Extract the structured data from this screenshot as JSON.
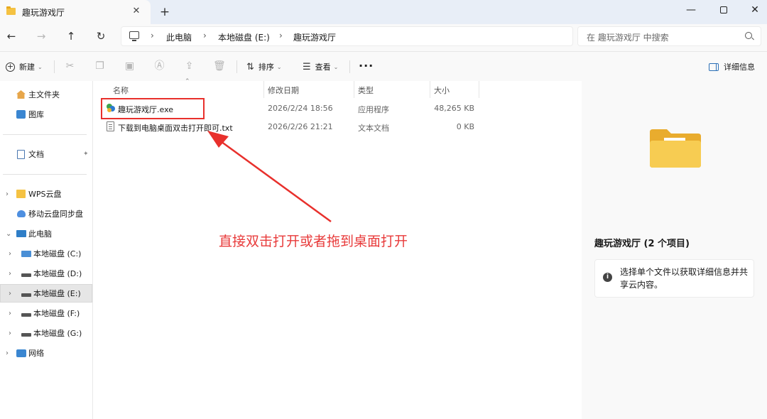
{
  "window": {
    "tab_title": "趣玩游戏厅",
    "tab_close": "✕",
    "new_tab": "+",
    "minimize": "—",
    "close": "✕"
  },
  "nav": {
    "back": "←",
    "forward": "→",
    "up": "↑",
    "refresh": "↻"
  },
  "breadcrumb": [
    {
      "label": "此电脑"
    },
    {
      "label": "本地磁盘 (E:)"
    },
    {
      "label": "趣玩游戏厅"
    }
  ],
  "breadcrumb_separator": "›",
  "search": {
    "placeholder": "在 趣玩游戏厅 中搜索"
  },
  "toolbar": {
    "new_label": "新建",
    "sort_label": "排序",
    "view_label": "查看",
    "more": "···",
    "details_label": "详细信息",
    "caret": "⌄"
  },
  "sidebar": {
    "items": [
      {
        "label": "主文件夹",
        "icon": "home-icon"
      },
      {
        "label": "图库",
        "icon": "gallery-icon"
      },
      {
        "label": "文档",
        "icon": "document-icon"
      },
      {
        "label": "WPS云盘",
        "icon": "folder-icon"
      },
      {
        "label": "移动云盘同步盘",
        "icon": "cloud-icon"
      },
      {
        "label": "此电脑",
        "icon": "computer-icon"
      },
      {
        "label": "本地磁盘 (C:)",
        "icon": "drive-icon"
      },
      {
        "label": "本地磁盘 (D:)",
        "icon": "drive-icon"
      },
      {
        "label": "本地磁盘 (E:)",
        "icon": "drive-icon",
        "selected": true
      },
      {
        "label": "本地磁盘 (F:)",
        "icon": "drive-icon"
      },
      {
        "label": "本地磁盘 (G:)",
        "icon": "drive-icon"
      },
      {
        "label": "网络",
        "icon": "network-icon"
      }
    ]
  },
  "file_list": {
    "columns": [
      "名称",
      "修改日期",
      "类型",
      "大小"
    ],
    "rows": [
      {
        "name": "趣玩游戏厅.exe",
        "modified": "2026/2/24 18:56",
        "type": "应用程序",
        "size": "48,265 KB"
      },
      {
        "name": "下载到电脑桌面双击打开即可.txt",
        "modified": "2026/2/26 21:21",
        "type": "文本文档",
        "size": "0 KB"
      }
    ]
  },
  "annotation": {
    "text": "直接双击打开或者拖到桌面打开",
    "color": "#e83a3a"
  },
  "details_pane": {
    "title": "趣玩游戏厅 (2 个项目)",
    "info": "选择单个文件以获取详细信息并共享云内容。"
  },
  "colors": {
    "accent": "#2a6fb6",
    "annotation_red": "#e8302c",
    "selected_bg": "#e6e6e6"
  }
}
